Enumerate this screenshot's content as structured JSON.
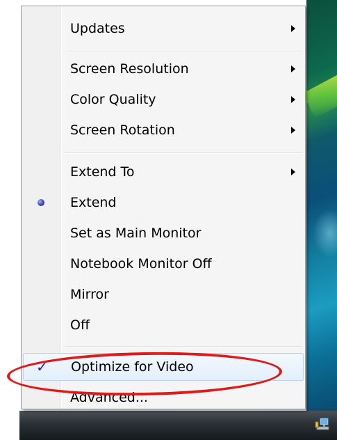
{
  "context_menu": {
    "items": [
      {
        "label": "Updates",
        "has_submenu": true
      },
      {
        "label": "Screen Resolution",
        "has_submenu": true
      },
      {
        "label": "Color Quality",
        "has_submenu": true
      },
      {
        "label": "Screen Rotation",
        "has_submenu": true
      },
      {
        "label": "Extend To",
        "has_submenu": true
      },
      {
        "label": "Extend",
        "radio_selected": true
      },
      {
        "label": "Set as Main Monitor"
      },
      {
        "label": "Notebook Monitor Off"
      },
      {
        "label": "Mirror"
      },
      {
        "label": "Off"
      },
      {
        "label": "Optimize for Video",
        "checked": true,
        "highlighted": true
      },
      {
        "label": "Advanced..."
      }
    ],
    "check_glyph": "✓"
  },
  "colors": {
    "annotation_ellipse": "#e01919",
    "highlight_border": "#b7d2ee",
    "check_color": "#1b2a9a",
    "radio_bullet": "#3a45b8"
  },
  "icons": {
    "submenu_arrow": "chevron-right-icon",
    "radio": "radio-bullet-icon",
    "check": "checkmark-icon",
    "tray": "network-tray-icon"
  }
}
